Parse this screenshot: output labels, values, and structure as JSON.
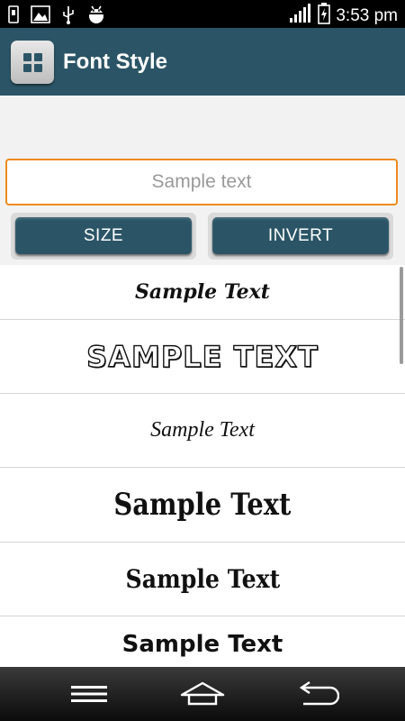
{
  "status_bar": {
    "time": "3:53 pm",
    "left_icons": [
      "usb-icon",
      "image-icon",
      "usb-debug-icon",
      "android-debug-icon"
    ],
    "right_icons": [
      "signal-icon",
      "battery-charging-icon"
    ]
  },
  "action_bar": {
    "title": "Font Style",
    "app_icon": "grid-app-icon",
    "background_color": "#2b5566"
  },
  "input": {
    "placeholder": "Sample text",
    "value": ""
  },
  "buttons": {
    "size_label": "SIZE",
    "invert_label": "INVERT"
  },
  "font_list": {
    "items": [
      {
        "text": "Sample Text"
      },
      {
        "text": "SAMPLE TEXT"
      },
      {
        "text": "Sample Text"
      },
      {
        "text": "Sample Text"
      },
      {
        "text": "Sample Text"
      },
      {
        "text": "Sample Text"
      }
    ]
  },
  "nav_bar": {
    "icons": [
      "menu-icon",
      "home-icon",
      "back-icon"
    ]
  },
  "colors": {
    "accent_orange": "#f08a1c",
    "button_teal": "#2b5566"
  }
}
